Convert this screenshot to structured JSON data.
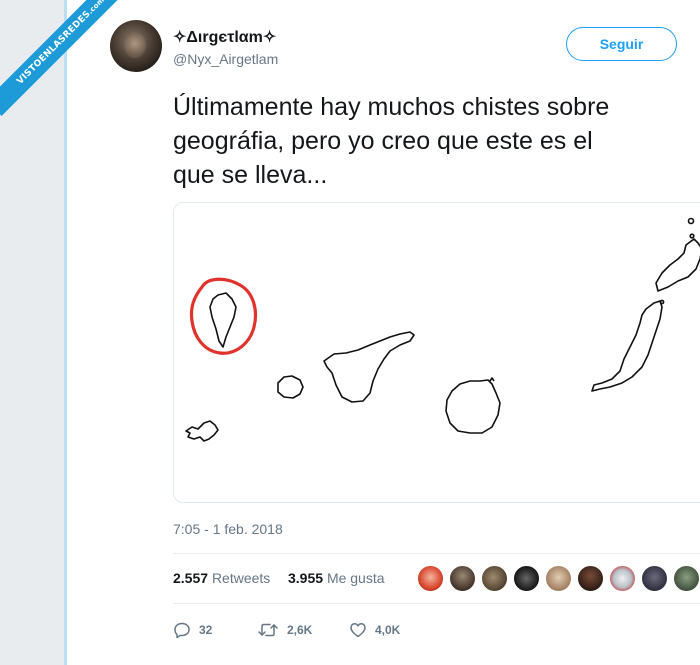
{
  "watermark": {
    "text": "VISTOENLASREDES",
    "subtext": ".com"
  },
  "user": {
    "display_name": "✧Διrgєτlαm✧",
    "handle": "@Nyx_Airgetlam"
  },
  "follow_button": {
    "label": "Seguir"
  },
  "tweet": {
    "text_line1": "Últimamente hay muchos chistes sobre",
    "text_line2": "geográfia, pero yo creo que este es el",
    "text_line3": "que se lleva...",
    "timestamp": "7:05 - 1 feb. 2018"
  },
  "stats": {
    "retweets_count": "2.557",
    "retweets_label": "Retweets",
    "likes_count": "3.955",
    "likes_label": "Me gusta"
  },
  "actions": {
    "replies": "32",
    "retweets": "2,6K",
    "likes": "4,0K"
  },
  "colors": {
    "accent": "#1da1f2",
    "text": "#14171a",
    "muted": "#657786",
    "circle_annotation": "#e0332b"
  },
  "icons": [
    "chevron-down-icon",
    "reply-icon",
    "retweet-icon",
    "heart-icon"
  ]
}
